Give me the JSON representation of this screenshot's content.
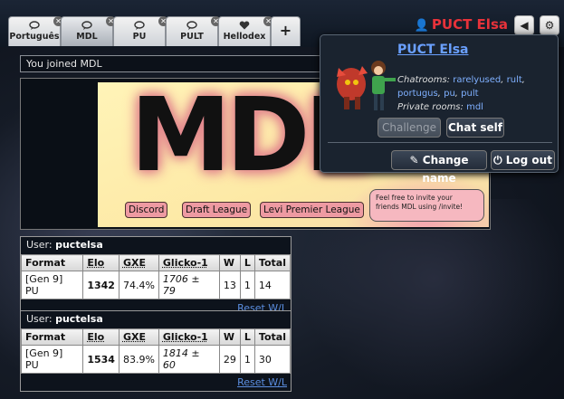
{
  "tabs": [
    {
      "label": "Português",
      "icon": "chat-bubble-icon"
    },
    {
      "label": "MDL",
      "icon": "chat-bubble-icon",
      "active": true
    },
    {
      "label": "PU",
      "icon": "chat-bubble-icon"
    },
    {
      "label": "PULT",
      "icon": "chat-bubble-icon"
    },
    {
      "label": "Hellodex",
      "icon": "heart-icon"
    }
  ],
  "new_tab_label": "+",
  "username": "PUCT Elsa",
  "room": {
    "joined_message": "You joined MDL",
    "banner": {
      "title": "MDL",
      "buttons": [
        "Discord",
        "Draft League",
        "Levi Premier League"
      ],
      "speech": "Feel free to invite your friends MDL using /invite!"
    }
  },
  "ladders": [
    {
      "user_label": "User:",
      "user": "puctelsa",
      "headers": [
        "Format",
        "Elo",
        "GXE",
        "Glicko-1",
        "W",
        "L",
        "Total"
      ],
      "row": [
        "[Gen 9] PU",
        "1342",
        "74.4%",
        "1706 ± 79",
        "13",
        "1",
        "14"
      ],
      "reset_label": "Reset W/L"
    },
    {
      "user_label": "User:",
      "user": "puctelsa",
      "headers": [
        "Format",
        "Elo",
        "GXE",
        "Glicko-1",
        "W",
        "L",
        "Total"
      ],
      "row": [
        "[Gen 9] PU",
        "1534",
        "83.9%",
        "1814 ± 60",
        "29",
        "1",
        "30"
      ],
      "reset_label": "Reset W/L"
    }
  ],
  "popup": {
    "name": "PUCT Elsa",
    "chatrooms_label": "Chatrooms:",
    "chatrooms": [
      "rarelyused",
      "rult",
      "portugus",
      "pu",
      "pult"
    ],
    "private_label": "Private rooms:",
    "private_rooms": [
      "mdl"
    ],
    "challenge_label": "Challenge",
    "chat_self_label": "Chat self",
    "change_name_label": "Change name",
    "logout_label": "Log out"
  },
  "colors": {
    "username": "#e8323a",
    "link": "#7fb0ff",
    "banner_bg": "#fde9a6",
    "banner_button": "#ee9aa2"
  }
}
